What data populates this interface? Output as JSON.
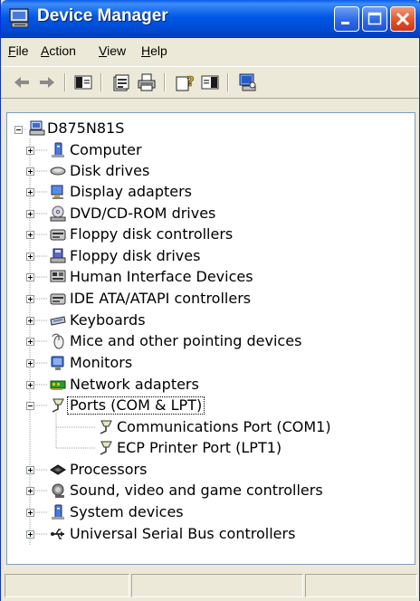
{
  "window": {
    "title": "Device Manager"
  },
  "menu": [
    {
      "mnemonic": "F",
      "rest": "ile"
    },
    {
      "mnemonic": "A",
      "rest": "ction"
    },
    {
      "mnemonic": "V",
      "rest": "iew"
    },
    {
      "mnemonic": "H",
      "rest": "elp"
    }
  ],
  "toolbar": [
    "back-arrow-icon",
    "forward-arrow-icon",
    "console-tree-icon",
    "properties-icon",
    "print-icon",
    "help-icon",
    "action-pane-icon",
    "scan-hardware-icon"
  ],
  "colors": {
    "title_bar": "#0058e6",
    "window_bg": "#ece9d8",
    "close_button": "#e2542b"
  },
  "tree": {
    "root": "D875N81S",
    "categories": [
      "Computer",
      "Disk drives",
      "Display adapters",
      "DVD/CD-ROM drives",
      "Floppy disk controllers",
      "Floppy disk drives",
      "Human Interface Devices",
      "IDE ATA/ATAPI controllers",
      "Keyboards",
      "Mice and other pointing devices",
      "Monitors",
      "Network adapters",
      "Ports (COM & LPT)",
      "Processors",
      "Sound, video and game controllers",
      "System devices",
      "Universal Serial Bus controllers"
    ],
    "expanded_category": "Ports (COM & LPT)",
    "ports_children": [
      "Communications Port (COM1)",
      "ECP Printer Port (LPT1)"
    ]
  }
}
